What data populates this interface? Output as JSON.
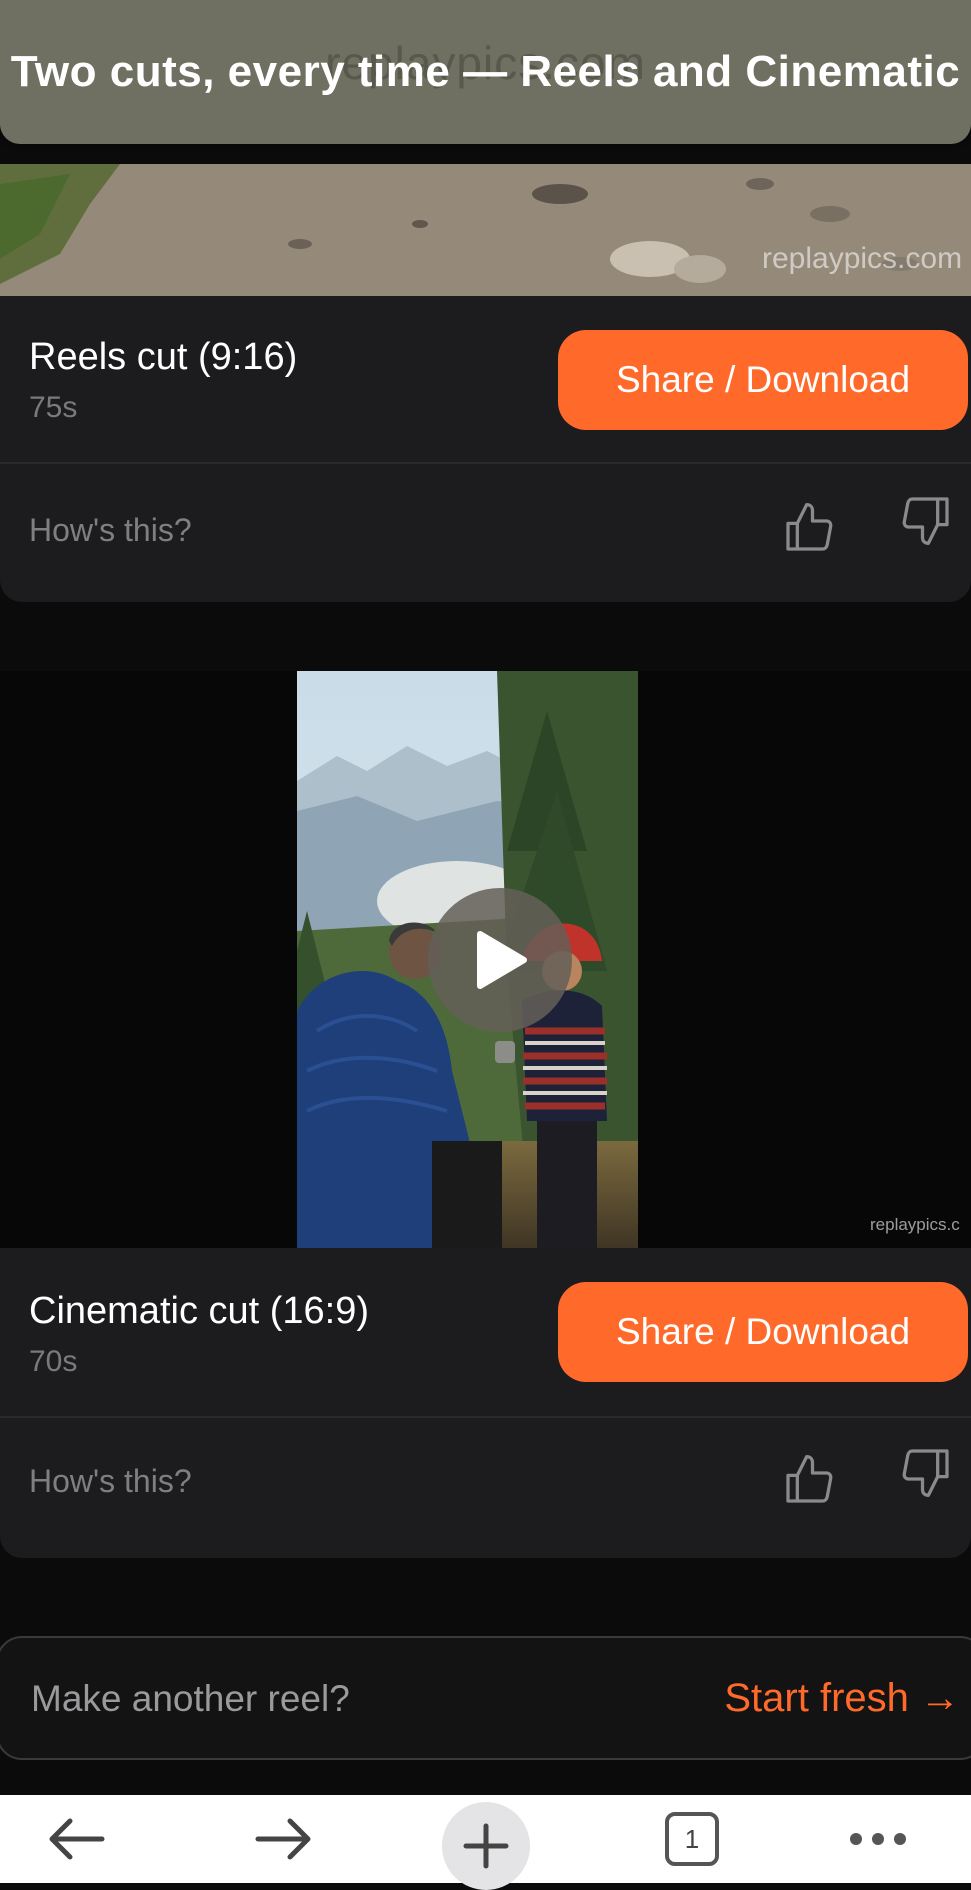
{
  "banner": {
    "title": "Two cuts, every time — Reels and Cinematic",
    "url_ghost": "replaypics.com"
  },
  "watermark": "replaypics.com",
  "cards": [
    {
      "title": "Reels cut (9:16)",
      "duration": "75s",
      "share_label": "Share / Download",
      "feedback_prompt": "How's this?"
    },
    {
      "title": "Cinematic cut (16:9)",
      "duration": "70s",
      "share_label": "Share / Download",
      "feedback_prompt": "How's this?"
    }
  ],
  "player": {
    "watermark": "replaypics.c"
  },
  "fresh": {
    "prompt": "Make another reel?",
    "link_label": "Start fresh →"
  },
  "browser": {
    "tab_count": "1"
  },
  "colors": {
    "accent": "#ff6a2b",
    "banner": "#6f7061",
    "card": "#1c1c1e"
  }
}
